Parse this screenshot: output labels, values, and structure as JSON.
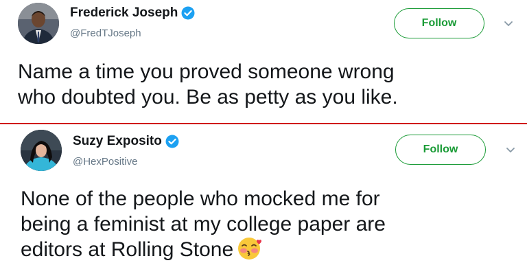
{
  "tweets": [
    {
      "display_name": "Frederick Joseph",
      "handle": "@FredTJoseph",
      "follow_label": "Follow",
      "text_lines": [
        "Name a time you proved someone wrong",
        "who doubted you. Be as petty as you like."
      ]
    },
    {
      "display_name": "Suzy Exposito",
      "handle": "@HexPositive",
      "follow_label": "Follow",
      "text_lines": [
        "None of the people who mocked me for",
        "being a feminist at my college paper are",
        "editors at Rolling Stone"
      ],
      "emoji": "kissing-face-with-closed-eyes"
    }
  ],
  "colors": {
    "follow_green": "#1a9b36",
    "verified_blue": "#1da1f2",
    "divider_red": "#d01818",
    "handle_gray": "#657786"
  }
}
